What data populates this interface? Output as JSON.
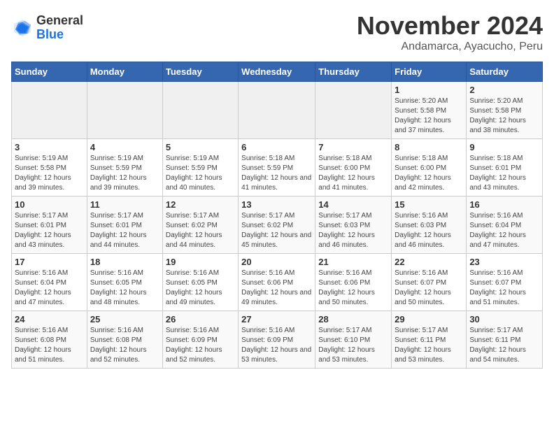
{
  "logo": {
    "general": "General",
    "blue": "Blue"
  },
  "title": "November 2024",
  "location": "Andamarca, Ayacucho, Peru",
  "days_of_week": [
    "Sunday",
    "Monday",
    "Tuesday",
    "Wednesday",
    "Thursday",
    "Friday",
    "Saturday"
  ],
  "weeks": [
    [
      {
        "num": "",
        "info": ""
      },
      {
        "num": "",
        "info": ""
      },
      {
        "num": "",
        "info": ""
      },
      {
        "num": "",
        "info": ""
      },
      {
        "num": "",
        "info": ""
      },
      {
        "num": "1",
        "info": "Sunrise: 5:20 AM\nSunset: 5:58 PM\nDaylight: 12 hours and 37 minutes."
      },
      {
        "num": "2",
        "info": "Sunrise: 5:20 AM\nSunset: 5:58 PM\nDaylight: 12 hours and 38 minutes."
      }
    ],
    [
      {
        "num": "3",
        "info": "Sunrise: 5:19 AM\nSunset: 5:58 PM\nDaylight: 12 hours and 39 minutes."
      },
      {
        "num": "4",
        "info": "Sunrise: 5:19 AM\nSunset: 5:59 PM\nDaylight: 12 hours and 39 minutes."
      },
      {
        "num": "5",
        "info": "Sunrise: 5:19 AM\nSunset: 5:59 PM\nDaylight: 12 hours and 40 minutes."
      },
      {
        "num": "6",
        "info": "Sunrise: 5:18 AM\nSunset: 5:59 PM\nDaylight: 12 hours and 41 minutes."
      },
      {
        "num": "7",
        "info": "Sunrise: 5:18 AM\nSunset: 6:00 PM\nDaylight: 12 hours and 41 minutes."
      },
      {
        "num": "8",
        "info": "Sunrise: 5:18 AM\nSunset: 6:00 PM\nDaylight: 12 hours and 42 minutes."
      },
      {
        "num": "9",
        "info": "Sunrise: 5:18 AM\nSunset: 6:01 PM\nDaylight: 12 hours and 43 minutes."
      }
    ],
    [
      {
        "num": "10",
        "info": "Sunrise: 5:17 AM\nSunset: 6:01 PM\nDaylight: 12 hours and 43 minutes."
      },
      {
        "num": "11",
        "info": "Sunrise: 5:17 AM\nSunset: 6:01 PM\nDaylight: 12 hours and 44 minutes."
      },
      {
        "num": "12",
        "info": "Sunrise: 5:17 AM\nSunset: 6:02 PM\nDaylight: 12 hours and 44 minutes."
      },
      {
        "num": "13",
        "info": "Sunrise: 5:17 AM\nSunset: 6:02 PM\nDaylight: 12 hours and 45 minutes."
      },
      {
        "num": "14",
        "info": "Sunrise: 5:17 AM\nSunset: 6:03 PM\nDaylight: 12 hours and 46 minutes."
      },
      {
        "num": "15",
        "info": "Sunrise: 5:16 AM\nSunset: 6:03 PM\nDaylight: 12 hours and 46 minutes."
      },
      {
        "num": "16",
        "info": "Sunrise: 5:16 AM\nSunset: 6:04 PM\nDaylight: 12 hours and 47 minutes."
      }
    ],
    [
      {
        "num": "17",
        "info": "Sunrise: 5:16 AM\nSunset: 6:04 PM\nDaylight: 12 hours and 47 minutes."
      },
      {
        "num": "18",
        "info": "Sunrise: 5:16 AM\nSunset: 6:05 PM\nDaylight: 12 hours and 48 minutes."
      },
      {
        "num": "19",
        "info": "Sunrise: 5:16 AM\nSunset: 6:05 PM\nDaylight: 12 hours and 49 minutes."
      },
      {
        "num": "20",
        "info": "Sunrise: 5:16 AM\nSunset: 6:06 PM\nDaylight: 12 hours and 49 minutes."
      },
      {
        "num": "21",
        "info": "Sunrise: 5:16 AM\nSunset: 6:06 PM\nDaylight: 12 hours and 50 minutes."
      },
      {
        "num": "22",
        "info": "Sunrise: 5:16 AM\nSunset: 6:07 PM\nDaylight: 12 hours and 50 minutes."
      },
      {
        "num": "23",
        "info": "Sunrise: 5:16 AM\nSunset: 6:07 PM\nDaylight: 12 hours and 51 minutes."
      }
    ],
    [
      {
        "num": "24",
        "info": "Sunrise: 5:16 AM\nSunset: 6:08 PM\nDaylight: 12 hours and 51 minutes."
      },
      {
        "num": "25",
        "info": "Sunrise: 5:16 AM\nSunset: 6:08 PM\nDaylight: 12 hours and 52 minutes."
      },
      {
        "num": "26",
        "info": "Sunrise: 5:16 AM\nSunset: 6:09 PM\nDaylight: 12 hours and 52 minutes."
      },
      {
        "num": "27",
        "info": "Sunrise: 5:16 AM\nSunset: 6:09 PM\nDaylight: 12 hours and 53 minutes."
      },
      {
        "num": "28",
        "info": "Sunrise: 5:17 AM\nSunset: 6:10 PM\nDaylight: 12 hours and 53 minutes."
      },
      {
        "num": "29",
        "info": "Sunrise: 5:17 AM\nSunset: 6:11 PM\nDaylight: 12 hours and 53 minutes."
      },
      {
        "num": "30",
        "info": "Sunrise: 5:17 AM\nSunset: 6:11 PM\nDaylight: 12 hours and 54 minutes."
      }
    ]
  ]
}
